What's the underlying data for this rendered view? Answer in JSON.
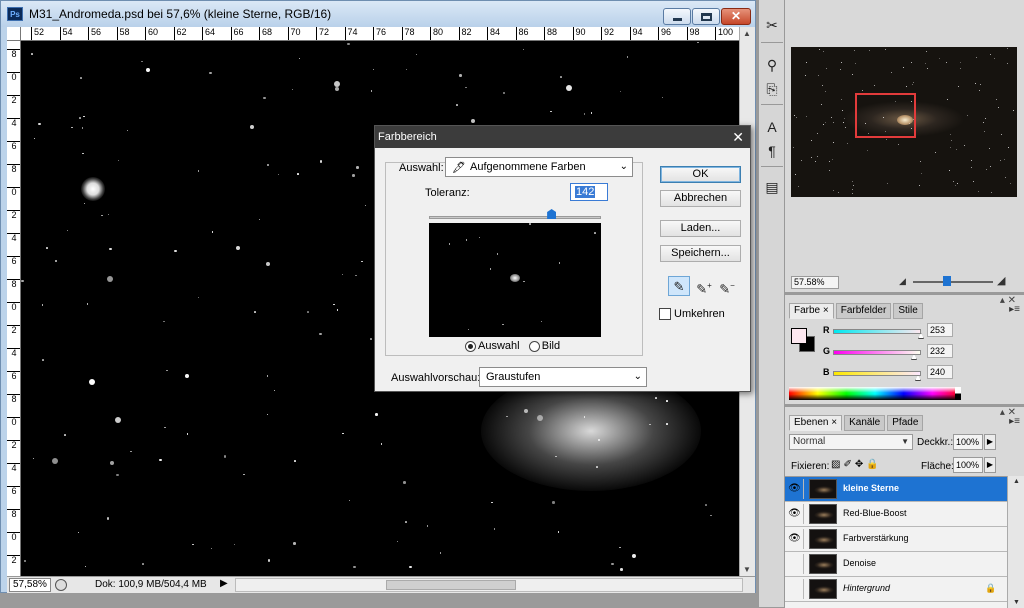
{
  "document": {
    "title": "M31_Andromeda.psd bei 57,6% (kleine Sterne, RGB/16)",
    "app_icon": "Ps",
    "ruler_top": [
      "52",
      "54",
      "56",
      "58",
      "60",
      "62",
      "64",
      "66",
      "68",
      "70",
      "72",
      "74",
      "76",
      "78",
      "80",
      "82",
      "84",
      "86",
      "88",
      "90",
      "92",
      "94",
      "96",
      "98",
      "100"
    ],
    "ruler_left": [
      "8",
      "0",
      "2",
      "4",
      "6",
      "8",
      "0",
      "2",
      "4",
      "6",
      "8",
      "0",
      "2",
      "4",
      "6",
      "8",
      "0",
      "2",
      "4",
      "6",
      "8",
      "0",
      "2"
    ],
    "status": {
      "zoom": "57,58%",
      "doc_info": "Dok: 100,9 MB/504,4 MB",
      "arrow": "▶"
    }
  },
  "dialog": {
    "title": "Farbbereich",
    "close": "✕",
    "select_label": "Auswahl:",
    "select_value": "Aufgenommene Farben",
    "tolerance_label": "Toleranz:",
    "tolerance_value": "142",
    "tolerance_fraction": 0.71,
    "radio_selection": "Auswahl",
    "radio_image": "Bild",
    "preview_label": "Auswahlvorschau:",
    "preview_value": "Graustufen",
    "buttons": {
      "ok": "OK",
      "cancel": "Abbrechen",
      "load": "Laden...",
      "save": "Speichern..."
    },
    "invert_label": "Umkehren",
    "eyedropper_icons": [
      "eyedropper-icon",
      "eyedropper-plus-icon",
      "eyedropper-minus-icon"
    ]
  },
  "tools": [
    "tools-icon",
    "clone-stamp-icon",
    "history-brush-icon",
    "character-icon",
    "paragraph-icon",
    "notes-icon"
  ],
  "navigator": {
    "zoom": "57.58%",
    "view_box_color": "#e23b3b"
  },
  "color_panel": {
    "tabs": [
      "Farbe",
      "Farbfelder",
      "Stile"
    ],
    "active_tab_close": "×",
    "r_label": "R",
    "r_value": "253",
    "g_label": "G",
    "g_value": "232",
    "b_label": "B",
    "b_value": "240",
    "foreground_color": "#fde8f0",
    "background_color": "#000000",
    "menu": "▸≡",
    "topbar": "▴ ✕"
  },
  "layers_panel": {
    "tabs": [
      "Ebenen",
      "Kanäle",
      "Pfade"
    ],
    "active_tab_close": "×",
    "blend_mode": "Normal",
    "opacity_label": "Deckkr.:",
    "opacity_value": "100%",
    "lock_label": "Fixieren:",
    "fill_label": "Fläche:",
    "fill_value": "100%",
    "menu": "▸≡",
    "topbar": "▴ ✕",
    "layers": [
      {
        "name": "kleine Sterne",
        "visible": true,
        "selected": true
      },
      {
        "name": "Red-Blue-Boost",
        "visible": true,
        "selected": false
      },
      {
        "name": "Farbverstärkung",
        "visible": true,
        "selected": false
      },
      {
        "name": "Denoise",
        "visible": false,
        "selected": false
      },
      {
        "name": "Hintergrund",
        "visible": false,
        "selected": false,
        "locked": true
      }
    ]
  }
}
